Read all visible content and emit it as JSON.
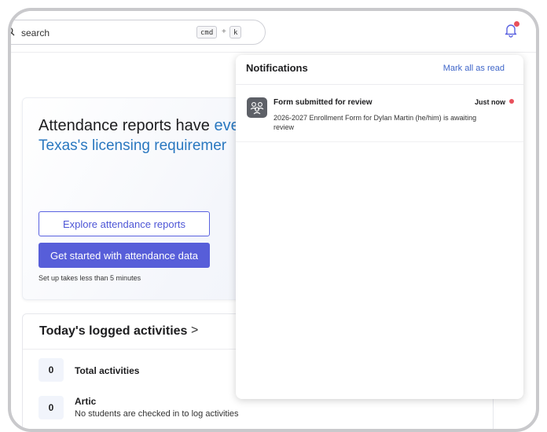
{
  "search": {
    "placeholder": "search",
    "shortcut_key1": "cmd",
    "shortcut_plus": "+",
    "shortcut_key2": "k"
  },
  "header": {
    "bell_icon": "bell-icon",
    "unread_indicator_color": "#e8505b"
  },
  "attendance_card": {
    "title_prefix": "Attendance reports have ",
    "title_accent": "eve",
    "subtitle": "Texas's licensing requiremer",
    "explore_button": "Explore attendance reports",
    "get_started_button": "Get started with attendance data",
    "setup_note": "Set up takes less than 5 minutes"
  },
  "activities": {
    "title": "Today's logged activities",
    "chevron": ">",
    "rows": [
      {
        "count": "0",
        "label": "Total activities",
        "desc": ""
      },
      {
        "count": "0",
        "label": "Artic",
        "desc": "No students are checked in to log activities"
      }
    ]
  },
  "notifications": {
    "title": "Notifications",
    "mark_all": "Mark all as read",
    "items": [
      {
        "icon": "group-icon",
        "title": "Form submitted for review",
        "time": "Just now",
        "body": "2026-2027 Enrollment Form for Dylan Martin (he/him) is awaiting review"
      }
    ]
  },
  "colors": {
    "accent": "#575ed9",
    "link": "#3f66c9",
    "heading_accent": "#2a78c0"
  }
}
